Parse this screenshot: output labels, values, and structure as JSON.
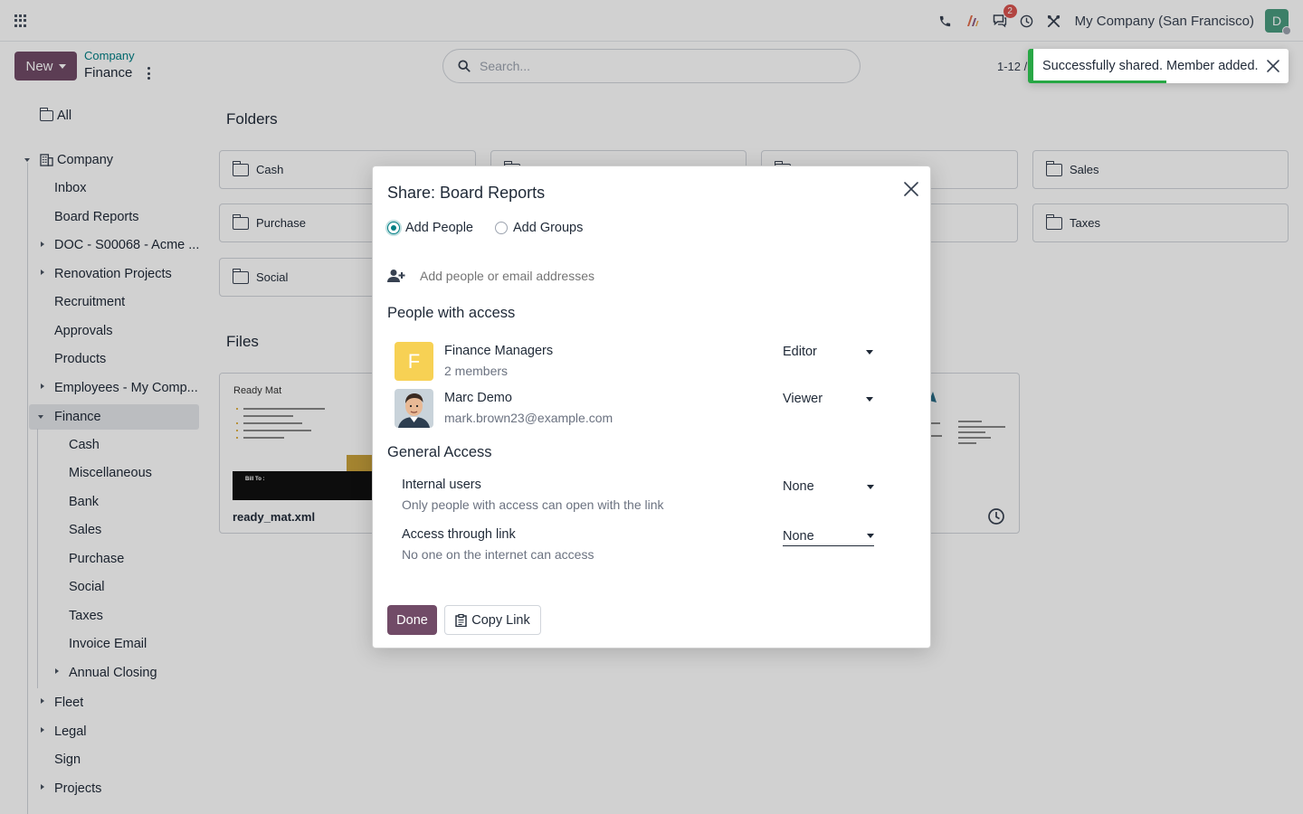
{
  "navbar": {
    "company": "My Company (San Francisco)",
    "messages_badge": "2",
    "user_initial": "D"
  },
  "control_panel": {
    "new_label": "New",
    "breadcrumb_parent": "Company",
    "breadcrumb_current": "Finance",
    "search_placeholder": "Search...",
    "pager": "1-12 /"
  },
  "sidebar": {
    "all_label": "All",
    "company_label": "Company",
    "items": [
      {
        "label": "Inbox"
      },
      {
        "label": "Board Reports"
      },
      {
        "label": "DOC - S00068 - Acme ..."
      },
      {
        "label": "Renovation Projects"
      },
      {
        "label": "Recruitment"
      },
      {
        "label": "Approvals"
      },
      {
        "label": "Products"
      },
      {
        "label": "Employees - My Comp..."
      },
      {
        "label": "Finance"
      },
      {
        "label": "Cash"
      },
      {
        "label": "Miscellaneous"
      },
      {
        "label": "Bank"
      },
      {
        "label": "Sales"
      },
      {
        "label": "Purchase"
      },
      {
        "label": "Social"
      },
      {
        "label": "Taxes"
      },
      {
        "label": "Invoice Email"
      },
      {
        "label": "Annual Closing"
      },
      {
        "label": "Fleet"
      },
      {
        "label": "Legal"
      },
      {
        "label": "Sign"
      },
      {
        "label": "Projects"
      }
    ]
  },
  "content": {
    "folders_title": "Folders",
    "files_title": "Files",
    "folders": [
      {
        "label": "Cash"
      },
      {
        "label": ""
      },
      {
        "label": ""
      },
      {
        "label": "Sales"
      },
      {
        "label": "Purchase"
      },
      {
        "label": ""
      },
      {
        "label": ""
      },
      {
        "label": "Taxes"
      },
      {
        "label": "Social"
      }
    ],
    "file_name": "ready_mat.xml",
    "file_preview_company": "Ready Mat",
    "file_preview_bill_to": "Bill To :"
  },
  "modal": {
    "title": "Share: Board Reports",
    "radio_people": "Add People",
    "radio_groups": "Add Groups",
    "add_placeholder": "Add people or email addresses",
    "people_title": "People with access",
    "people": [
      {
        "name": "Finance Managers",
        "sub": "2 members",
        "role": "Editor",
        "initial": "F"
      },
      {
        "name": "Marc Demo",
        "sub": "mark.brown23@example.com",
        "role": "Viewer"
      }
    ],
    "general_title": "General Access",
    "internal_label": "Internal users",
    "internal_desc": "Only people with access can open with the link",
    "internal_value": "None",
    "link_label": "Access through link",
    "link_desc": "No one on the internet can access",
    "link_value": "None",
    "done_label": "Done",
    "copy_label": "Copy Link"
  },
  "toast": {
    "message": "Successfully shared. Member added.",
    "progress": 0.52
  },
  "colors": {
    "primary": "#714B67",
    "accent": "#017e84",
    "success": "#28a745"
  }
}
